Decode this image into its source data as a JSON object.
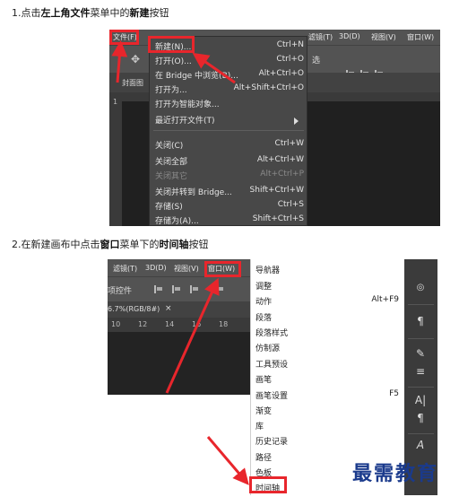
{
  "step1": {
    "number": "1.",
    "pre": "点击",
    "bold1": "左上角文件",
    "mid": "菜单中的",
    "bold2": "新建",
    "post": "按钮"
  },
  "step2": {
    "number": "2.",
    "pre": "在新建画布中点击",
    "bold1": "窗口",
    "mid": "菜单下的",
    "bold2": "时间轴",
    "post": "按钮"
  },
  "shot1": {
    "menubar": {
      "file": "文件(F)",
      "filter": "滤镜(T)",
      "3d": "3D(D)",
      "view": "视图(V)",
      "window": "窗口(W)"
    },
    "tab_label": "封面图",
    "ruler_mark": "1",
    "file_menu": [
      {
        "label": "新建(N)...",
        "shortcut": "Ctrl+N"
      },
      {
        "label": "打开(O)...",
        "shortcut": "Ctrl+O"
      },
      {
        "label": "在 Bridge 中浏览(B)...",
        "shortcut": "Alt+Ctrl+O"
      },
      {
        "label": "打开为...",
        "shortcut": "Alt+Shift+Ctrl+O"
      },
      {
        "label": "打开为智能对象...",
        "shortcut": ""
      },
      {
        "label": "最近打开文件(T)",
        "shortcut": ""
      },
      {
        "label": "关闭(C)",
        "shortcut": "Ctrl+W"
      },
      {
        "label": "关闭全部",
        "shortcut": "Alt+Ctrl+W"
      },
      {
        "label": "关闭其它",
        "shortcut": "Alt+Ctrl+P"
      },
      {
        "label": "关闭并转到 Bridge...",
        "shortcut": "Shift+Ctrl+W"
      },
      {
        "label": "存储(S)",
        "shortcut": "Ctrl+S"
      },
      {
        "label": "存储为(A)...",
        "shortcut": "Shift+Ctrl+S"
      }
    ],
    "right_label": "选"
  },
  "shot2": {
    "menubar": {
      "filter": "滤镜(T)",
      "3d": "3D(D)",
      "view": "视图(V)",
      "window": "窗口(W)"
    },
    "opt_label": "项控件",
    "tab_label": "6.7%(RGB/8#)",
    "tab_close": "×",
    "ruler_ticks": [
      "10",
      "12",
      "14",
      "16",
      "18"
    ],
    "window_menu": [
      {
        "label": "导航器",
        "shortcut": ""
      },
      {
        "label": "调整",
        "shortcut": ""
      },
      {
        "label": "动作",
        "shortcut": "Alt+F9"
      },
      {
        "label": "段落",
        "shortcut": ""
      },
      {
        "label": "段落样式",
        "shortcut": ""
      },
      {
        "label": "仿制源",
        "shortcut": ""
      },
      {
        "label": "工具预设",
        "shortcut": ""
      },
      {
        "label": "画笔",
        "shortcut": ""
      },
      {
        "label": "画笔设置",
        "shortcut": "F5"
      },
      {
        "label": "渐变",
        "shortcut": ""
      },
      {
        "label": "库",
        "shortcut": ""
      },
      {
        "label": "历史记录",
        "shortcut": ""
      },
      {
        "label": "路径",
        "shortcut": ""
      },
      {
        "label": "色板",
        "shortcut": ""
      },
      {
        "label": "时间轴",
        "shortcut": ""
      }
    ],
    "panel_icons": [
      "¶",
      "A|",
      "¶",
      "A"
    ]
  },
  "watermark": "最需教育",
  "colors": {
    "highlight": "#e8262c",
    "arrow": "#e8262c",
    "watermark": "#1a3a8c"
  }
}
